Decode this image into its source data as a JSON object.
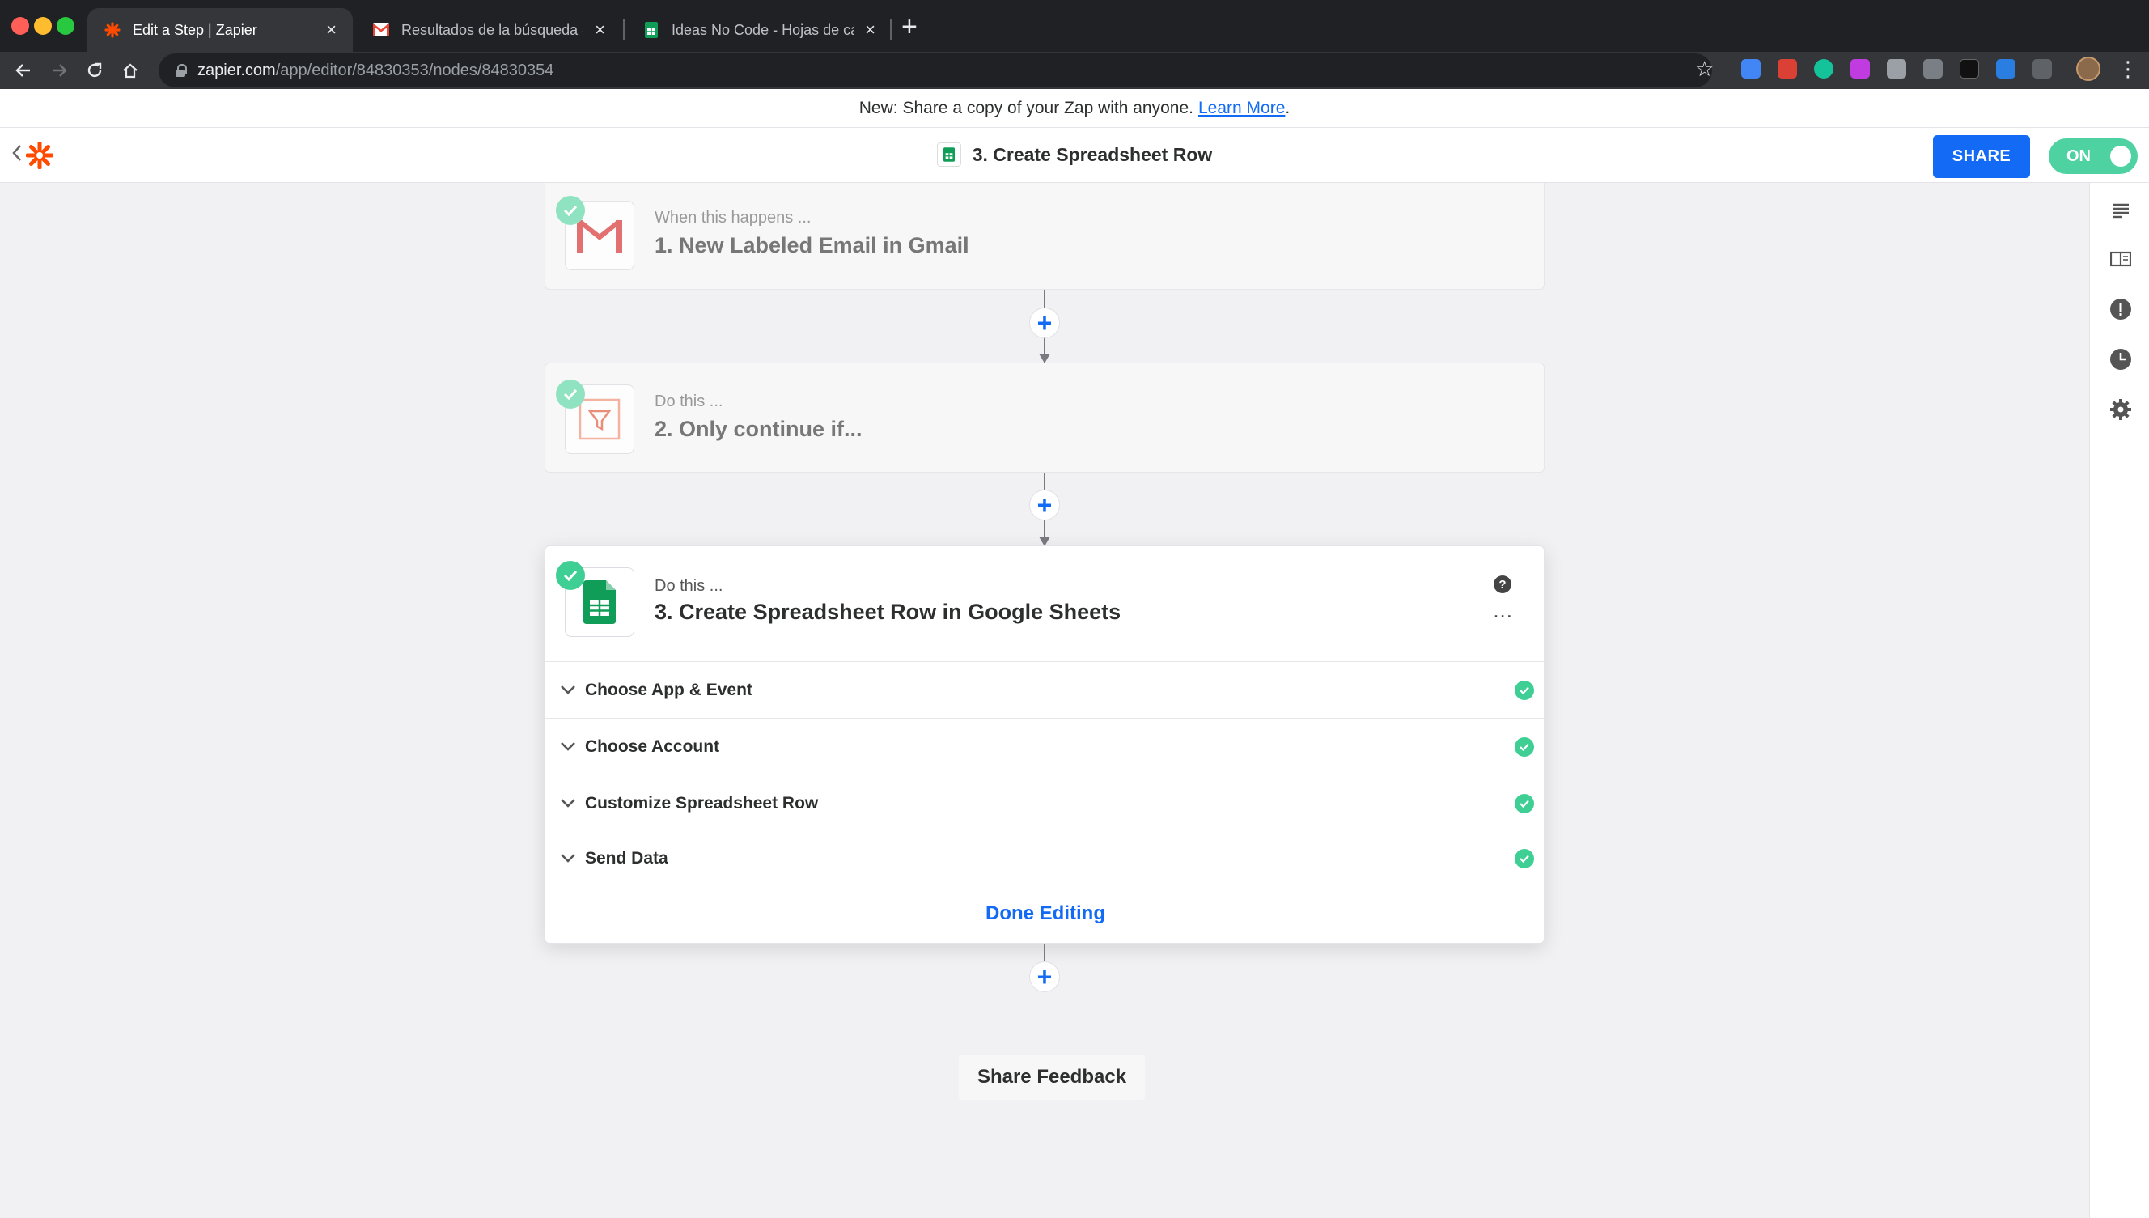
{
  "browser": {
    "tabs": [
      {
        "title": "Edit a Step | Zapier",
        "icon": "zapier-icon",
        "active": true
      },
      {
        "title": "Resultados de la búsqueda - os",
        "icon": "gmail-icon",
        "active": false
      },
      {
        "title": "Ideas No Code - Hojas de cálcul",
        "icon": "sheets-icon",
        "active": false
      }
    ],
    "close_glyph": "×",
    "new_tab_glyph": "+",
    "url_host": "zapier.com",
    "url_path": "/app/editor/84830353/nodes/84830354"
  },
  "announcement": {
    "text": "New: Share a copy of your Zap with anyone.",
    "link": "Learn More",
    "suffix": "."
  },
  "header": {
    "title": "3. Create Spreadsheet Row",
    "share_label": "SHARE",
    "toggle_label": "ON"
  },
  "steps": [
    {
      "subtitle": "When this happens ...",
      "title": "1. New Labeled Email in Gmail",
      "app": "gmail-icon"
    },
    {
      "subtitle": "Do this ...",
      "title": "2. Only continue if...",
      "app": "filter-icon"
    },
    {
      "subtitle": "Do this ...",
      "title": "3. Create Spreadsheet Row in Google Sheets",
      "app": "google-sheets-icon"
    }
  ],
  "active_step": {
    "help_glyph": "?",
    "more_glyph": "...",
    "sections": [
      {
        "label": "Choose App & Event",
        "status": "complete"
      },
      {
        "label": "Choose Account",
        "status": "complete"
      },
      {
        "label": "Customize Spreadsheet Row",
        "status": "complete"
      },
      {
        "label": "Send Data",
        "status": "complete"
      }
    ],
    "done_label": "Done Editing"
  },
  "add_step_glyph": "+",
  "feedback_label": "Share Feedback",
  "colors": {
    "accent": "#136bf5",
    "success": "#3fcf95",
    "zapier_orange": "#ff4a00",
    "sheets_green": "#0f9d58",
    "gmail_red": "#ea4335"
  }
}
